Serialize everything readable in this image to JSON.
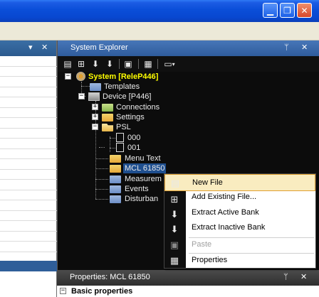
{
  "window": {
    "minimize_icon": "minimize-icon",
    "maximize_icon": "maximize-icon",
    "close_icon": "close-icon"
  },
  "left_panel": {
    "dropdown_glyph": "▾",
    "close_glyph": "✕"
  },
  "explorer": {
    "title": "System Explorer",
    "pin_glyph": "ᛘ",
    "close_glyph": "✕",
    "toolbar": [
      {
        "name": "new-file-icon",
        "glyph": "▤"
      },
      {
        "name": "add-existing-icon",
        "glyph": "⊞"
      },
      {
        "name": "extract-active-icon",
        "glyph": "⬇"
      },
      {
        "name": "extract-inactive-icon",
        "glyph": "⬇"
      },
      {
        "name": "clipboard-icon",
        "glyph": "▣"
      },
      {
        "name": "properties-icon",
        "glyph": "▦"
      },
      {
        "name": "view-menu-icon",
        "glyph": "▭"
      }
    ],
    "tree": {
      "system": "System [ReleP446]",
      "templates": "Templates",
      "device": "Device [P446]",
      "connections": "Connections",
      "settings": "Settings",
      "psl": "PSL",
      "file_000": "000",
      "file_001": "001",
      "menu_text": "Menu Text",
      "mcl": "MCL 61850",
      "measurements": "Measurem",
      "events": "Events",
      "disturbance": "Disturban"
    }
  },
  "context_menu": {
    "new_file": "New File",
    "add_existing": "Add Existing File...",
    "extract_active": "Extract Active Bank",
    "extract_inactive": "Extract Inactive Bank",
    "paste": "Paste",
    "properties": "Properties"
  },
  "properties": {
    "title": "Properties: MCL 61850",
    "pin_glyph": "ᛘ",
    "close_glyph": "✕",
    "category": "Basic properties",
    "collapse_glyph": "−"
  },
  "colors": {
    "selection_highlight": "#f9ecc0",
    "system_label": "#ffff00"
  }
}
